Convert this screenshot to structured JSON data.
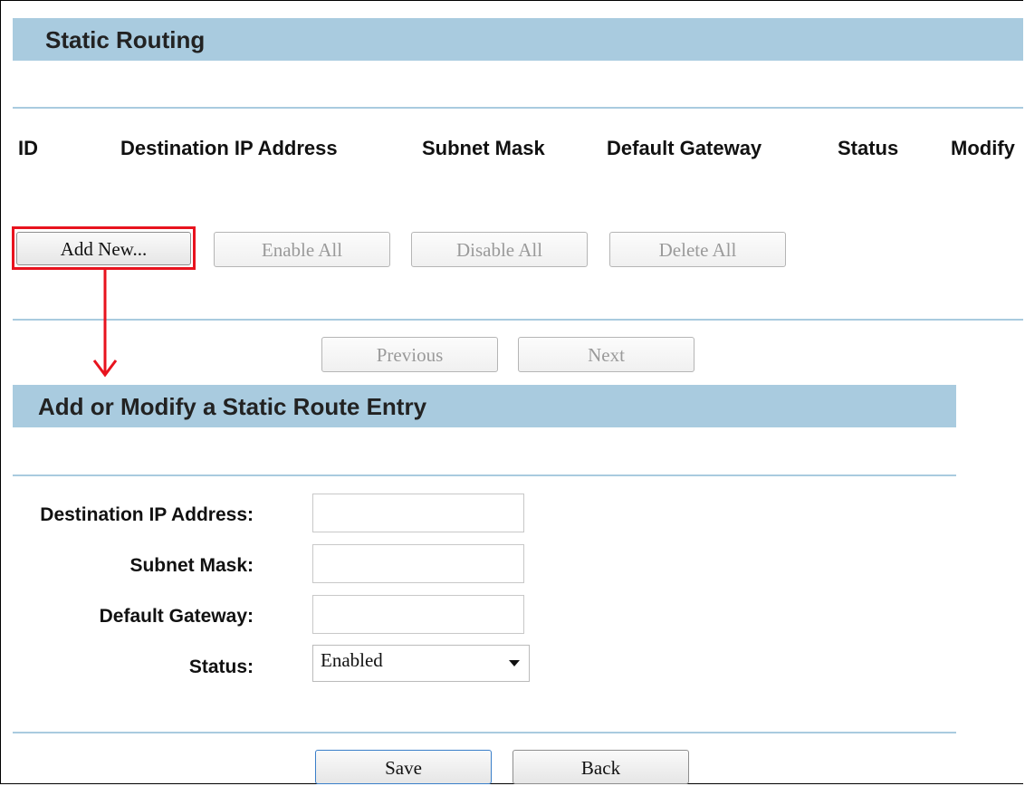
{
  "static_routing": {
    "title": "Static Routing",
    "columns": [
      "ID",
      "Destination IP Address",
      "Subnet Mask",
      "Default Gateway",
      "Status",
      "Modify"
    ],
    "buttons": {
      "add_new": "Add New...",
      "enable_all": "Enable All",
      "disable_all": "Disable All",
      "delete_all": "Delete All",
      "previous": "Previous",
      "next": "Next"
    }
  },
  "add_modify": {
    "title": "Add or Modify a Static Route Entry",
    "fields": {
      "destination_ip": {
        "label": "Destination IP Address:",
        "value": ""
      },
      "subnet_mask": {
        "label": "Subnet Mask:",
        "value": ""
      },
      "default_gateway": {
        "label": "Default Gateway:",
        "value": ""
      },
      "status": {
        "label": "Status:",
        "value": "Enabled"
      }
    },
    "buttons": {
      "save": "Save",
      "back": "Back"
    }
  },
  "colors": {
    "header_bg": "#a9cbdf",
    "highlight": "#e8131e"
  }
}
